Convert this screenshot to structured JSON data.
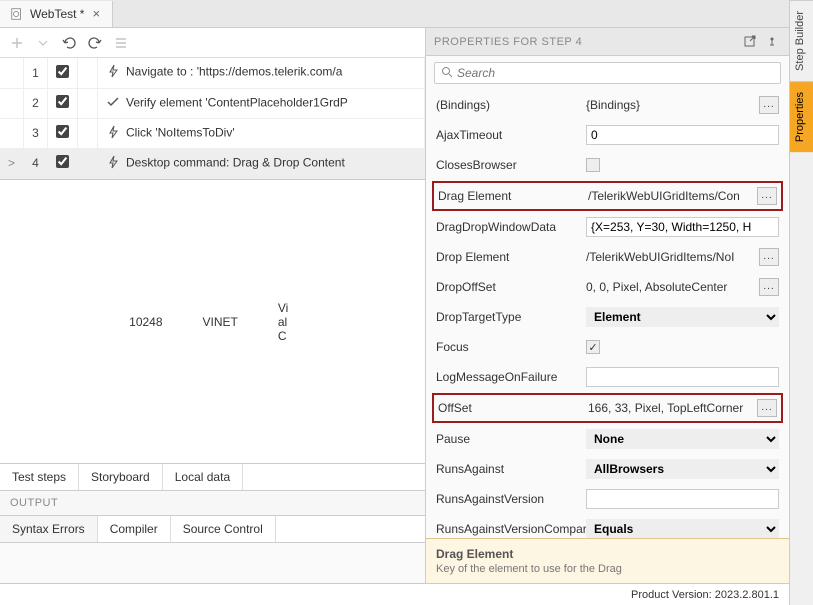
{
  "tab": {
    "title": "WebTest *"
  },
  "propsTitle": "PROPERTIES FOR STEP 4",
  "searchPlaceholder": "Search",
  "steps": [
    {
      "num": "1",
      "icon": "bolt",
      "desc": "Navigate to : 'https://demos.telerik.com/a"
    },
    {
      "num": "2",
      "icon": "check",
      "desc": "Verify element 'ContentPlaceholder1GrdP"
    },
    {
      "num": "3",
      "icon": "bolt",
      "desc": "Click 'NoItemsToDiv'"
    },
    {
      "num": "4",
      "icon": "bolt",
      "desc": "Desktop command: Drag & Drop Content"
    }
  ],
  "lower": {
    "a": "10248",
    "b": "VINET",
    "c": "Vi\nal\nC"
  },
  "subtabs": [
    "Test steps",
    "Storyboard",
    "Local data"
  ],
  "outputTitle": "OUTPUT",
  "outputTabs": [
    "Syntax Errors",
    "Compiler",
    "Source Control"
  ],
  "rightTabs": [
    "Step Builder",
    "Properties"
  ],
  "properties": [
    {
      "label": "(Bindings)",
      "value": "{Bindings}",
      "type": "textbtn"
    },
    {
      "label": "AjaxTimeout",
      "value": "0",
      "type": "input"
    },
    {
      "label": "ClosesBrowser",
      "value": "",
      "type": "check",
      "checked": false
    },
    {
      "label": "Drag Element",
      "value": "/TelerikWebUIGridItems/Con",
      "type": "textbtn",
      "hl": true
    },
    {
      "label": "DragDropWindowData",
      "value": "{X=253, Y=30, Width=1250, H",
      "type": "input"
    },
    {
      "label": "Drop Element",
      "value": "/TelerikWebUIGridItems/NoI",
      "type": "textbtn"
    },
    {
      "label": "DropOffSet",
      "value": "0, 0, Pixel, AbsoluteCenter",
      "type": "textbtn"
    },
    {
      "label": "DropTargetType",
      "value": "Element",
      "type": "select"
    },
    {
      "label": "Focus",
      "value": "",
      "type": "check",
      "checked": true
    },
    {
      "label": "LogMessageOnFailure",
      "value": "",
      "type": "input"
    },
    {
      "label": "OffSet",
      "value": "166, 33, Pixel, TopLeftCorner",
      "type": "textbtn",
      "hl": true
    },
    {
      "label": "Pause",
      "value": "None",
      "type": "select"
    },
    {
      "label": "RunsAgainst",
      "value": "AllBrowsers",
      "type": "select"
    },
    {
      "label": "RunsAgainstVersion",
      "value": "",
      "type": "input"
    },
    {
      "label": "RunsAgainstVersionCompare",
      "value": "Equals",
      "type": "select"
    }
  ],
  "help": {
    "title": "Drag Element",
    "desc": "Key of the element to use for the Drag"
  },
  "status": "Product Version: 2023.2.801.1"
}
